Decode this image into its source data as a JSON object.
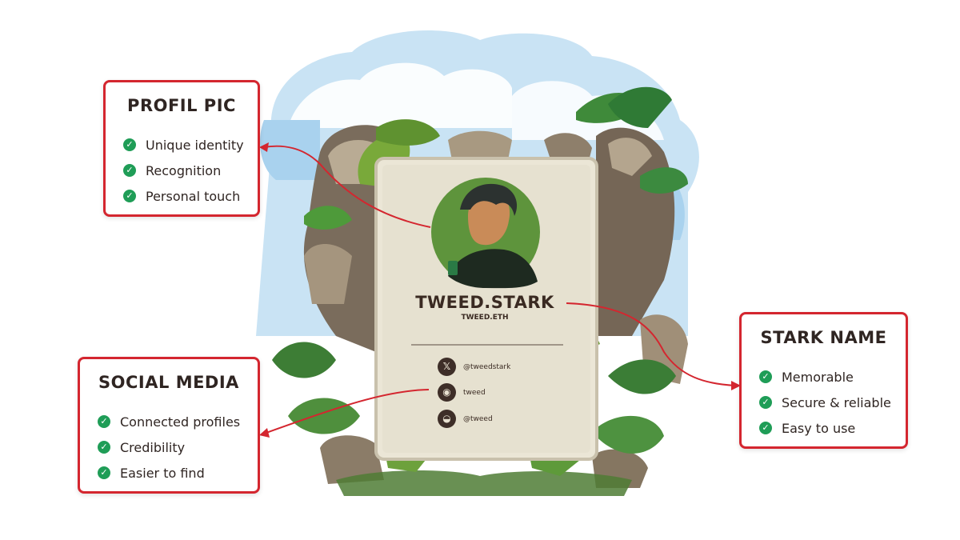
{
  "profile_box": {
    "title": "PROFIL PIC",
    "items": [
      "Unique identity",
      "Recognition",
      "Personal touch"
    ]
  },
  "social_box": {
    "title": "SOCIAL MEDIA",
    "items": [
      "Connected profiles",
      "Credibility",
      "Easier to find"
    ]
  },
  "name_box": {
    "title": "STARK NAME",
    "items": [
      "Memorable",
      "Secure & reliable",
      "Easy to use"
    ]
  },
  "card": {
    "name": "TWEED.STARK",
    "domain": "TWEED.ETH",
    "socials": [
      {
        "icon": "x-icon",
        "glyph": "𝕏",
        "handle": "@tweedstark"
      },
      {
        "icon": "github-icon",
        "glyph": "◉",
        "handle": "tweed"
      },
      {
        "icon": "discord-icon",
        "glyph": "◒",
        "handle": "@tweed"
      }
    ]
  },
  "check_glyph": "✓",
  "colors": {
    "accent_red": "#d4262f",
    "check_green": "#1f9d57",
    "card_bg": "#e6e0d0",
    "avatar_bg": "#5e943c",
    "text_dark": "#2f2522"
  }
}
